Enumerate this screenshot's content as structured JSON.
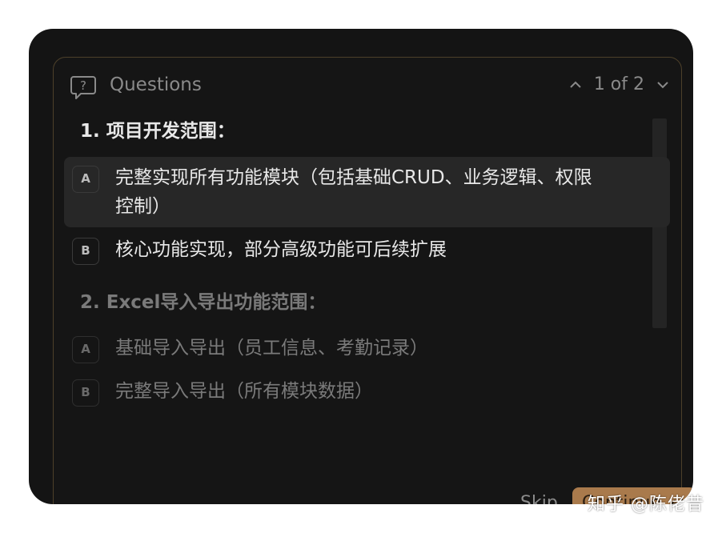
{
  "header": {
    "title": "Questions",
    "pager": "1 of 2",
    "icons": {
      "title_icon": "question-bubble-icon",
      "prev": "chevron-up-icon",
      "next": "chevron-down-icon"
    }
  },
  "questions": [
    {
      "heading": "1.  项目开发范围：",
      "options": [
        {
          "key": "A",
          "text_line1": "完整实现所有功能模块（包括基础CRUD、业务逻辑、权限",
          "text_line2": "控制）",
          "state": "highlighted"
        },
        {
          "key": "B",
          "text": "核心功能实现，部分高级功能可后续扩展"
        }
      ]
    },
    {
      "heading": "2.  Excel导入导出功能范围：",
      "options": [
        {
          "key": "A",
          "text": "基础导入导出（员工信息、考勤记录）"
        },
        {
          "key": "B",
          "text": "完整导入导出（所有模块数据）"
        }
      ]
    }
  ],
  "footer": {
    "skip_label": "Skip",
    "continue_label": "Continue",
    "continue_icon": "enter-return-icon"
  },
  "watermark": "知乎 @陈佬昔",
  "colors": {
    "accent": "#a97a4c",
    "panel_border": "#4d402a",
    "background": "#141414"
  }
}
